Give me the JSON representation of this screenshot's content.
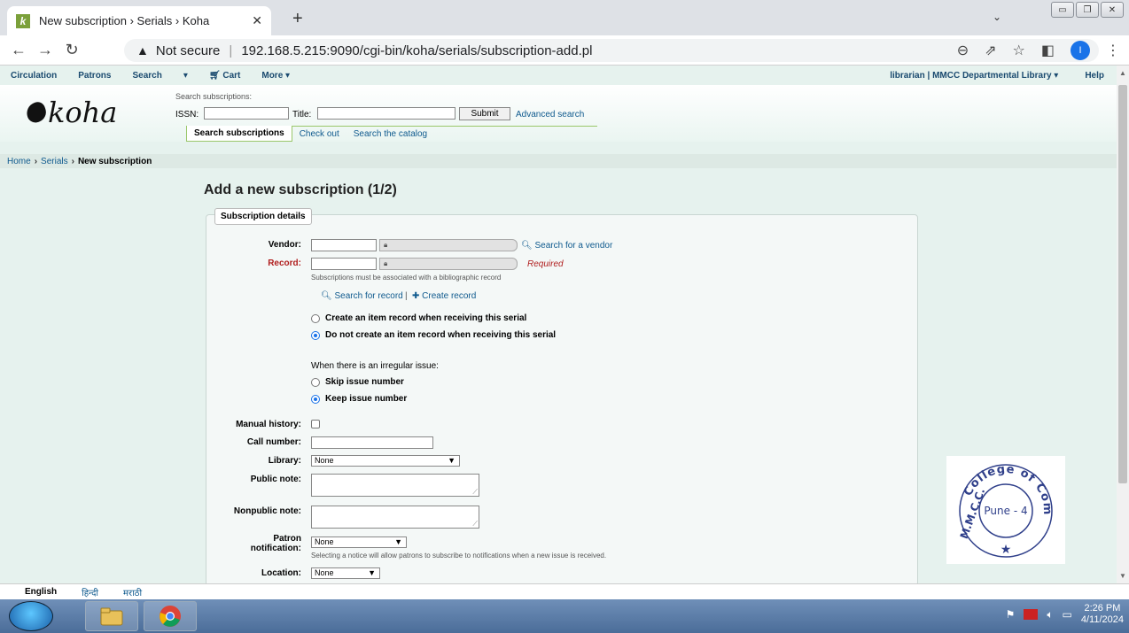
{
  "browser": {
    "tab_title": "New subscription › Serials › Koha",
    "url_warning": "Not secure",
    "url": "192.168.5.215:9090/cgi-bin/koha/serials/subscription-add.pl",
    "profile_initial": "I"
  },
  "topnav": {
    "items": [
      "Circulation",
      "Patrons",
      "Search",
      "▾",
      "Cart",
      "More ▾"
    ],
    "user": "librarian | MMCC Departmental Library ▾",
    "help": "Help"
  },
  "header": {
    "logo_text": "koha",
    "search_heading": "Search subscriptions:",
    "issn_label": "ISSN:",
    "title_label": "Title:",
    "submit_label": "Submit",
    "advanced_search": "Advanced search",
    "tabs": [
      "Search subscriptions",
      "Check out",
      "Search the catalog"
    ]
  },
  "breadcrumb": {
    "home": "Home",
    "serials": "Serials",
    "current": "New subscription"
  },
  "main": {
    "title": "Add a new subscription (1/2)",
    "legend": "Subscription details",
    "vendor_label": "Vendor:",
    "search_vendor": "Search for a vendor",
    "record_label": "Record:",
    "required": "Required",
    "record_hint": "Subscriptions must be associated with a bibliographic record",
    "search_record": "Search for record",
    "create_record": "Create record",
    "item_options": [
      {
        "label": "Create an item record when receiving this serial",
        "checked": false
      },
      {
        "label": "Do not create an item record when receiving this serial",
        "checked": true
      }
    ],
    "irregular_heading": "When there is an irregular issue:",
    "irregular_options": [
      {
        "label": "Skip issue number",
        "checked": false
      },
      {
        "label": "Keep issue number",
        "checked": true
      }
    ],
    "manual_history_label": "Manual history:",
    "call_number_label": "Call number:",
    "library_label": "Library:",
    "library_value": "None",
    "public_note_label": "Public note:",
    "nonpublic_note_label": "Nonpublic note:",
    "patron_notification_label_1": "Patron",
    "patron_notification_label_2": "notification:",
    "patron_notification_value": "None",
    "patron_notification_hint": "Selecting a notice will allow patrons to subscribe to notifications when a new issue is received.",
    "location_label": "Location:",
    "location_value": "None"
  },
  "stamp": {
    "top_text": "College of Commerce",
    "side_text": "M.M.C.C.",
    "center_text": "Pune - 4"
  },
  "languages": [
    "English",
    "हिन्दी",
    "मराठी"
  ],
  "taskbar": {
    "time": "2:26 PM",
    "date": "4/11/2024"
  },
  "colors": {
    "accent": "#0f5a8e",
    "required": "#b01e1e",
    "page_bg": "#e6f2ee"
  }
}
